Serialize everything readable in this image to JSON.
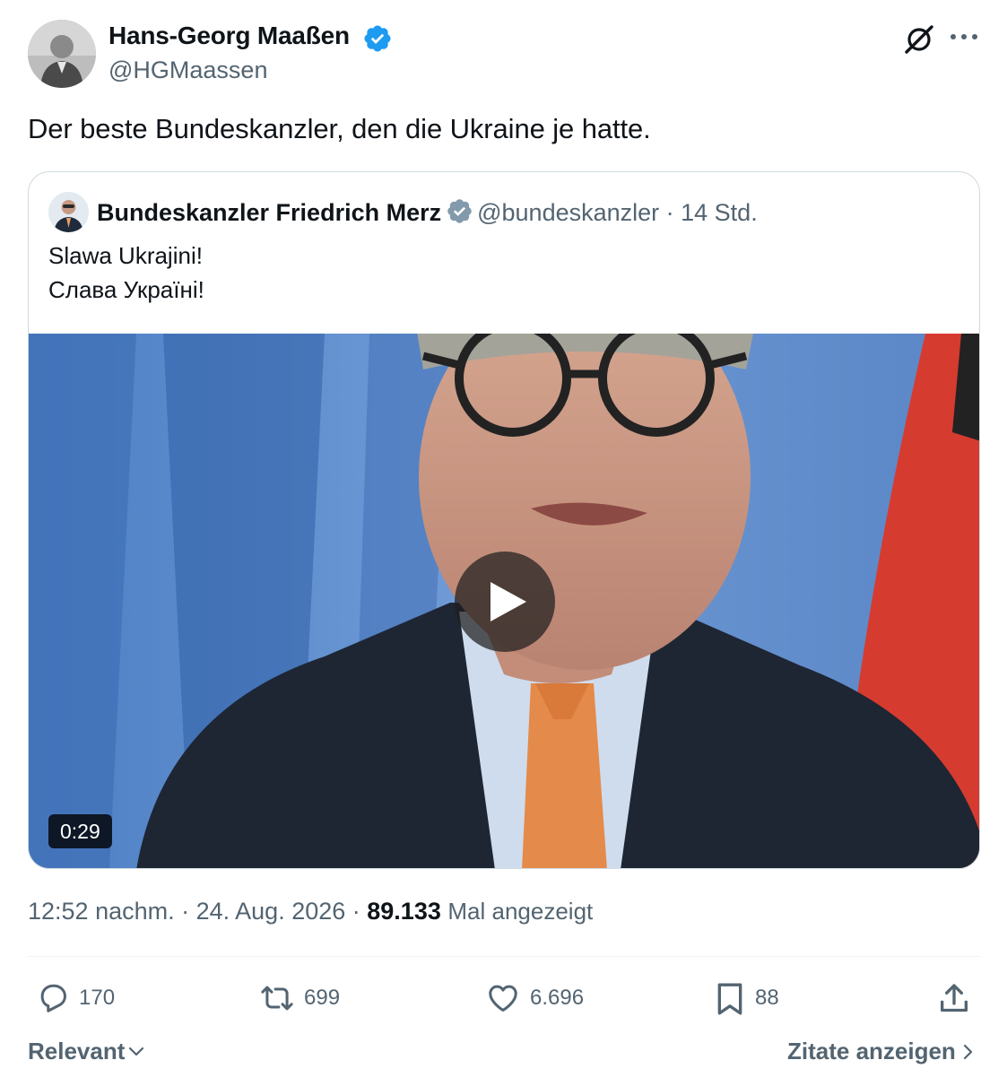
{
  "post": {
    "author": {
      "name": "Hans-Georg Maaßen",
      "handle": "@HGMaassen",
      "verified_color": "#1d9bf0"
    },
    "text": "Der beste Bundeskanzler, den die Ukraine je hatte.",
    "header_icons": [
      "grok-icon",
      "more-icon"
    ]
  },
  "quoted": {
    "author_name": "Bundeskanzler Friedrich Merz",
    "handle": "@bundeskanzler",
    "separator": " · ",
    "time": "14 Std.",
    "verified_color": "#829aab",
    "lines": [
      "Slawa Ukrajini!",
      "Слава Україні!"
    ],
    "video": {
      "duration": "0:29",
      "icon": "play-icon"
    }
  },
  "meta": {
    "time": "12:52 nachm.",
    "separator": " · ",
    "date": "24. Aug. 2026",
    "views_count": "89.133",
    "views_label": "Mal angezeigt"
  },
  "actions": {
    "replies": "170",
    "reposts": "699",
    "likes": "6.696",
    "bookmarks": "88",
    "icons": [
      "reply-icon",
      "repost-icon",
      "like-icon",
      "bookmark-icon",
      "share-icon"
    ]
  },
  "footer": {
    "sort_label": "Relevant",
    "quotes_label": "Zitate anzeigen"
  },
  "colors": {
    "text": "#0f1419",
    "secondary": "#536471",
    "border": "#cfd9de"
  }
}
